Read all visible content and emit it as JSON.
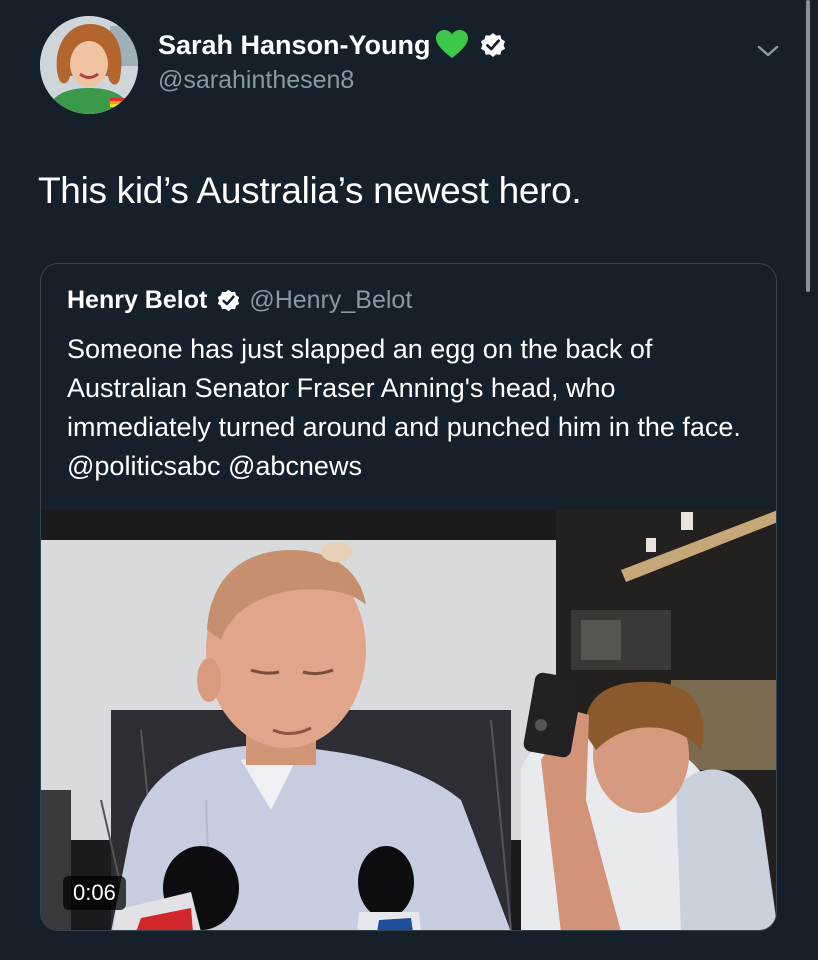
{
  "author": {
    "display_name": "Sarah Hanson-Young",
    "handle": "@sarahinthesen8",
    "name_emoji": "green-heart",
    "verified": true
  },
  "tweet": {
    "text": "This kid’s Australia’s newest hero."
  },
  "quoted_tweet": {
    "display_name": "Henry Belot",
    "handle": "@Henry_Belot",
    "verified": true,
    "text": "Someone has just slapped an egg on the back of Australian Senator Fraser Anning's head, who immediately turned around and punched him in the face. @politicsabc @abcnews",
    "video": {
      "duration": "0:06"
    }
  },
  "icons": {
    "menu": "chevron-down-icon",
    "verified": "verified-badge-icon",
    "emoji": "green-heart-icon"
  },
  "colors": {
    "background": "#15202b",
    "secondary_text": "#8899a6",
    "border": "#38444d",
    "heart": "#3ec84a"
  }
}
